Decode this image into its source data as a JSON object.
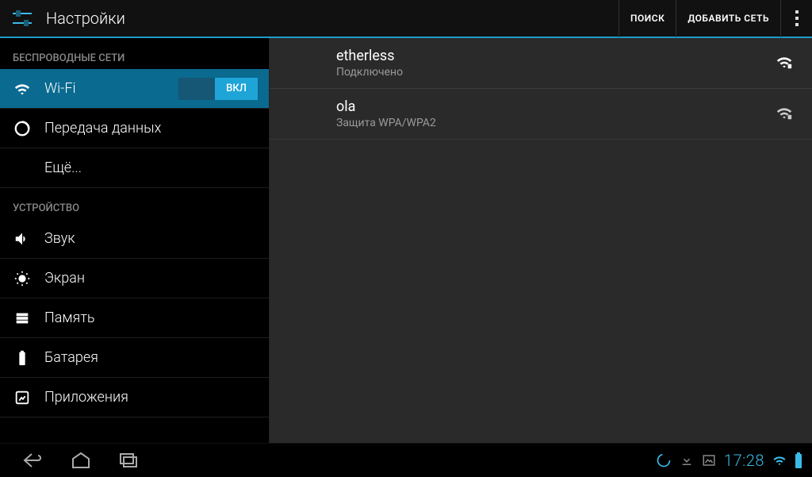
{
  "actionbar": {
    "title": "Настройки",
    "search": "ПОИСК",
    "add_network": "ДОБАВИТЬ СЕТЬ"
  },
  "sidebar": {
    "wireless_header": "БЕСПРОВОДНЫЕ СЕТИ",
    "device_header": "УСТРОЙСТВО",
    "wifi": "Wi-Fi",
    "wifi_switch": "ВКЛ",
    "data": "Передача данных",
    "more": "Ещё...",
    "sound": "Звук",
    "display": "Экран",
    "storage": "Память",
    "battery": "Батарея",
    "apps": "Приложения"
  },
  "networks": [
    {
      "name": "etherless",
      "sub": "Подключено",
      "secured": true,
      "connected": true
    },
    {
      "name": "ola",
      "sub": "Защита WPA/WPA2",
      "secured": true,
      "connected": false
    }
  ],
  "statusbar": {
    "time": "17:28"
  }
}
